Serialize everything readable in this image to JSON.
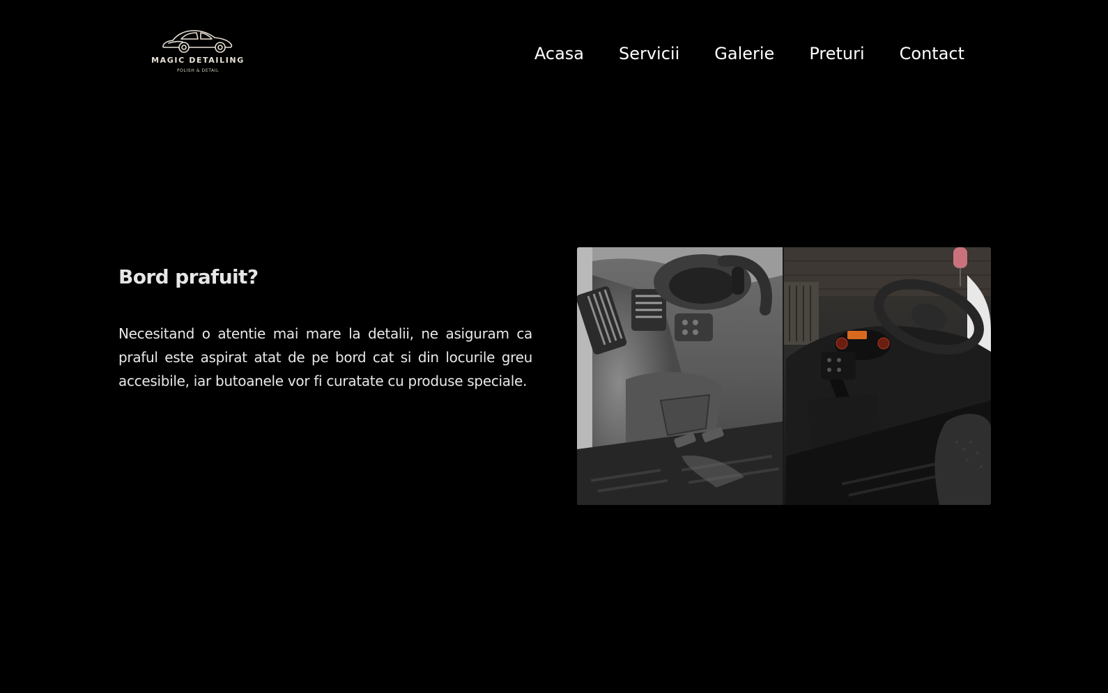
{
  "brand": {
    "name": "MAGIC DETAILING",
    "tagline": "POLISH & DETAIL",
    "logo_icon": "vintage-car-icon",
    "accent_color": "#eae3d6"
  },
  "nav": {
    "items": [
      {
        "label": "Acasa"
      },
      {
        "label": "Servicii"
      },
      {
        "label": "Galerie"
      },
      {
        "label": "Preturi"
      },
      {
        "label": "Contact"
      }
    ]
  },
  "section": {
    "heading": "Bord prafuit?",
    "body": "Necesitand o atentie mai mare la detalii, ne asiguram ca praful este aspirat atat de pe bord cat si din locurile greu accesibile, iar butoanele vor fi curatate cu produse speciale."
  },
  "colors": {
    "background": "#000000",
    "text": "#ffffff"
  }
}
